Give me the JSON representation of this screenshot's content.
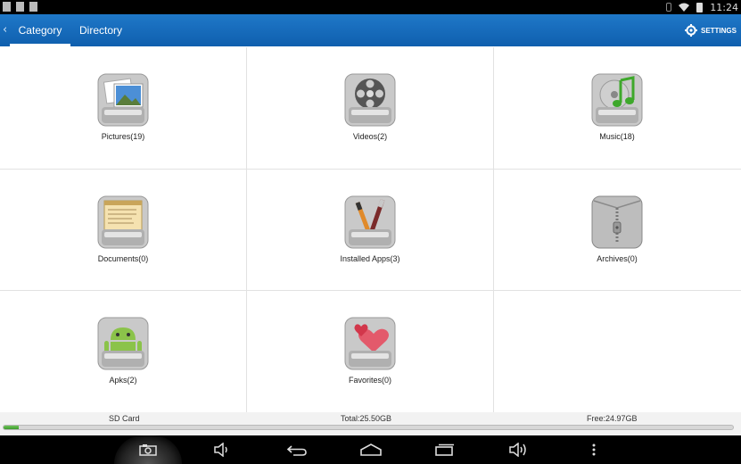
{
  "status_bar": {
    "time": "11:24"
  },
  "action_bar": {
    "tabs": [
      {
        "label": "Category",
        "selected": true
      },
      {
        "label": "Directory",
        "selected": false
      }
    ],
    "settings_label": "SETTINGS"
  },
  "categories": [
    {
      "label": "Pictures(19)",
      "icon": "pictures-icon"
    },
    {
      "label": "Videos(2)",
      "icon": "videos-icon"
    },
    {
      "label": "Music(18)",
      "icon": "music-icon"
    },
    {
      "label": "Documents(0)",
      "icon": "documents-icon"
    },
    {
      "label": "Installed Apps(3)",
      "icon": "installed-apps-icon"
    },
    {
      "label": "Archives(0)",
      "icon": "archives-icon"
    },
    {
      "label": "Apks(2)",
      "icon": "android-apk-icon"
    },
    {
      "label": "Favorites(0)",
      "icon": "favorites-hearts-icon"
    }
  ],
  "storage": {
    "name": "SD Card",
    "total": "Total:25.50GB",
    "free": "Free:24.97GB",
    "used_fraction": 0.021
  },
  "colors": {
    "action_bar": "#1a6fc0",
    "storage_fill": "#4caf3a"
  }
}
